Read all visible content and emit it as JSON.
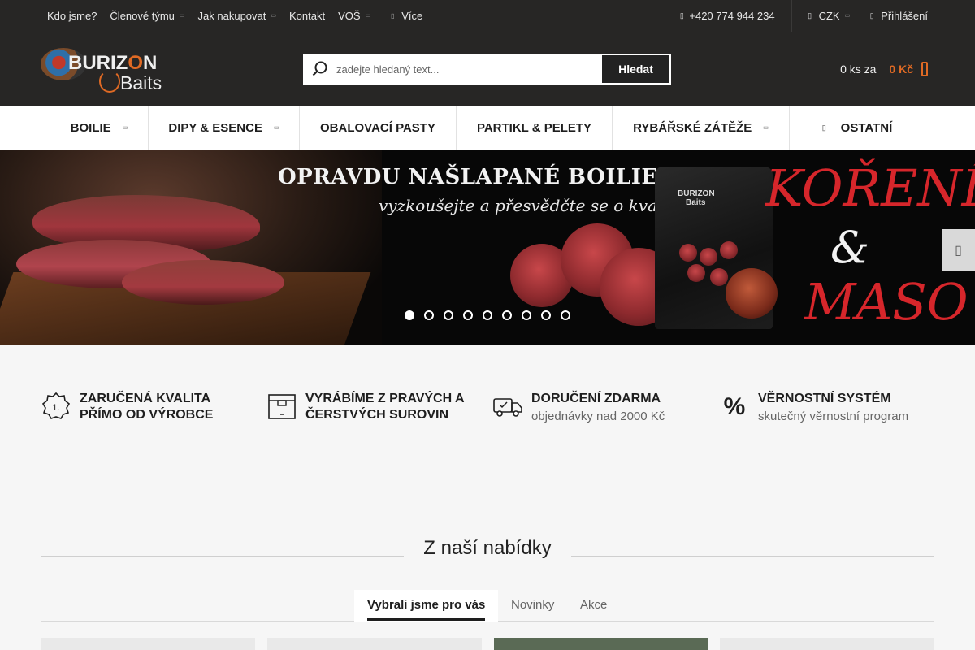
{
  "topbar": {
    "nav": [
      {
        "label": "Kdo jsme?",
        "dropdown": false
      },
      {
        "label": "Členové týmu",
        "dropdown": true
      },
      {
        "label": "Jak nakupovat",
        "dropdown": true
      },
      {
        "label": "Kontakt",
        "dropdown": false
      },
      {
        "label": "VOŠ",
        "dropdown": true
      }
    ],
    "more_label": "Více",
    "phone": "+420 774 944 234",
    "currency": "CZK",
    "login": "Přihlášení"
  },
  "header": {
    "logo_text_1": "BURIZ",
    "logo_text_o": "O",
    "logo_text_2": "N",
    "logo_text_3": "Baits",
    "search_placeholder": "zadejte hledaný text...",
    "search_button": "Hledat",
    "cart_count": "0 ks za",
    "cart_price": "0 Kč"
  },
  "categories": [
    {
      "label": "BOILIE",
      "dropdown": true
    },
    {
      "label": "DIPY & ESENCE",
      "dropdown": true
    },
    {
      "label": "OBALOVACÍ PASTY",
      "dropdown": false
    },
    {
      "label": "PARTIKL & PELETY",
      "dropdown": false
    },
    {
      "label": "RYBÁŘSKÉ ZÁTĚŽE",
      "dropdown": true
    },
    {
      "label": "OSTATNÍ",
      "dropdown": false
    }
  ],
  "banner": {
    "headline": "OPRAVDU NAŠLAPANÉ BOILIES",
    "subline": "vyzkoušejte a přesvědčte se o kvalitě",
    "product_label_1": "BURIZON",
    "product_label_2": "Baits",
    "spice": "KOŘENÍ",
    "amp": "&",
    "maso": "MASO",
    "slides": 9,
    "active_slide": 1
  },
  "benefits": [
    {
      "icon": "medal-icon",
      "title_1": "ZARUČENÁ KVALITA",
      "title_2": "PŘÍMO OD VÝROBCE",
      "desc": ""
    },
    {
      "icon": "box-icon",
      "title_1": "VYRÁBÍME Z PRAVÝCH A",
      "title_2": "ČERSTVÝCH SUROVIN",
      "desc": ""
    },
    {
      "icon": "truck-icon",
      "title_1": "DORUČENÍ ZDARMA",
      "title_2": "",
      "desc": "objednávky nad 2000 Kč"
    },
    {
      "icon": "percent-icon",
      "title_1": "VĚRNOSTNÍ SYSTÉM",
      "title_2": "",
      "desc": "skutečný věrnostní program"
    }
  ],
  "offer": {
    "title": "Z naší nabídky",
    "tabs": [
      "Vybrali jsme pro vás",
      "Novinky",
      "Akce"
    ],
    "active_tab": 0
  },
  "colors": {
    "dark": "#272625",
    "accent": "#e06a24",
    "banner_red": "#d6262b"
  }
}
